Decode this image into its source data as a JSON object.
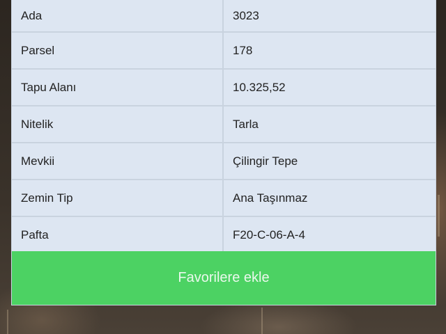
{
  "details": [
    {
      "label": "Ada",
      "value": "3023"
    },
    {
      "label": "Parsel",
      "value": "178"
    },
    {
      "label": "Tapu Alanı",
      "value": "10.325,52"
    },
    {
      "label": "Nitelik",
      "value": "Tarla"
    },
    {
      "label": "Mevkii",
      "value": "Çilingir Tepe"
    },
    {
      "label": "Zemin Tip",
      "value": "Ana Taşınmaz"
    },
    {
      "label": "Pafta",
      "value": "F20-C-06-A-4"
    }
  ],
  "actions": {
    "favorite_label": "Favorilere ekle"
  },
  "colors": {
    "button_green": "#4cd263",
    "table_background": "#dde6f2"
  }
}
